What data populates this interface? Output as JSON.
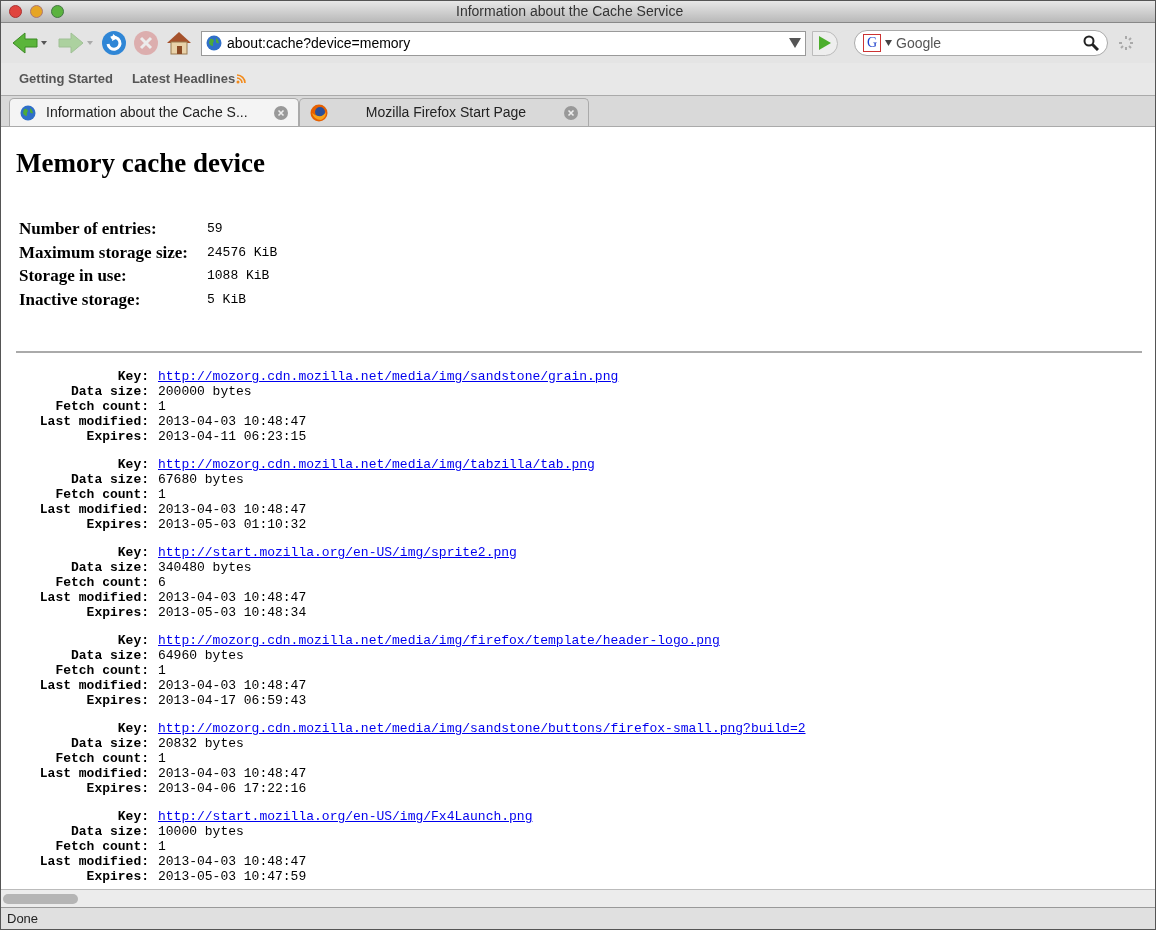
{
  "window": {
    "title": "Information about the Cache Service"
  },
  "toolbar": {
    "back_enabled": true,
    "forward_enabled": false,
    "stop_enabled": false,
    "address": "about:cache?device=memory",
    "search_engine": "G",
    "search_placeholder": "Google"
  },
  "bookmarks": [
    {
      "label": "Getting Started",
      "rss": false
    },
    {
      "label": "Latest Headlines",
      "rss": true
    }
  ],
  "tabs": [
    {
      "label": "Information about the Cache S...",
      "selected": true,
      "kind": "globe"
    },
    {
      "label": "Mozilla Firefox Start Page",
      "selected": false,
      "kind": "firefox"
    }
  ],
  "page": {
    "heading": "Memory cache device",
    "stats": [
      {
        "label": "Number of entries:",
        "value": "59"
      },
      {
        "label": "Maximum storage size:",
        "value": "24576 KiB"
      },
      {
        "label": "Storage in use:",
        "value": "1088 KiB"
      },
      {
        "label": "Inactive storage:",
        "value": "5 KiB"
      }
    ],
    "entries": [
      {
        "fields": [
          {
            "label": "Key:",
            "value": "http://mozorg.cdn.mozilla.net/media/img/sandstone/grain.png",
            "kind": "link"
          },
          {
            "label": "Data size:",
            "value": "200000 bytes",
            "kind": "text"
          },
          {
            "label": "Fetch count:",
            "value": "1",
            "kind": "text"
          },
          {
            "label": "Last modified:",
            "value": "2013-04-03 10:48:47",
            "kind": "text"
          },
          {
            "label": "Expires:",
            "value": "2013-04-11 06:23:15",
            "kind": "text"
          }
        ]
      },
      {
        "fields": [
          {
            "label": "Key:",
            "value": "http://mozorg.cdn.mozilla.net/media/img/tabzilla/tab.png",
            "kind": "link"
          },
          {
            "label": "Data size:",
            "value": "67680 bytes",
            "kind": "text"
          },
          {
            "label": "Fetch count:",
            "value": "1",
            "kind": "text"
          },
          {
            "label": "Last modified:",
            "value": "2013-04-03 10:48:47",
            "kind": "text"
          },
          {
            "label": "Expires:",
            "value": "2013-05-03 01:10:32",
            "kind": "text"
          }
        ]
      },
      {
        "fields": [
          {
            "label": "Key:",
            "value": "http://start.mozilla.org/en-US/img/sprite2.png",
            "kind": "link"
          },
          {
            "label": "Data size:",
            "value": "340480 bytes",
            "kind": "text"
          },
          {
            "label": "Fetch count:",
            "value": "6",
            "kind": "text"
          },
          {
            "label": "Last modified:",
            "value": "2013-04-03 10:48:47",
            "kind": "text"
          },
          {
            "label": "Expires:",
            "value": "2013-05-03 10:48:34",
            "kind": "text"
          }
        ]
      },
      {
        "fields": [
          {
            "label": "Key:",
            "value": "http://mozorg.cdn.mozilla.net/media/img/firefox/template/header-logo.png",
            "kind": "link"
          },
          {
            "label": "Data size:",
            "value": "64960 bytes",
            "kind": "text"
          },
          {
            "label": "Fetch count:",
            "value": "1",
            "kind": "text"
          },
          {
            "label": "Last modified:",
            "value": "2013-04-03 10:48:47",
            "kind": "text"
          },
          {
            "label": "Expires:",
            "value": "2013-04-17 06:59:43",
            "kind": "text"
          }
        ]
      },
      {
        "fields": [
          {
            "label": "Key:",
            "value": "http://mozorg.cdn.mozilla.net/media/img/sandstone/buttons/firefox-small.png?build=2",
            "kind": "link"
          },
          {
            "label": "Data size:",
            "value": "20832 bytes",
            "kind": "text"
          },
          {
            "label": "Fetch count:",
            "value": "1",
            "kind": "text"
          },
          {
            "label": "Last modified:",
            "value": "2013-04-03 10:48:47",
            "kind": "text"
          },
          {
            "label": "Expires:",
            "value": "2013-04-06 17:22:16",
            "kind": "text"
          }
        ]
      },
      {
        "fields": [
          {
            "label": "Key:",
            "value": "http://start.mozilla.org/en-US/img/Fx4Launch.png",
            "kind": "link"
          },
          {
            "label": "Data size:",
            "value": "10000 bytes",
            "kind": "text"
          },
          {
            "label": "Fetch count:",
            "value": "1",
            "kind": "text"
          },
          {
            "label": "Last modified:",
            "value": "2013-04-03 10:48:47",
            "kind": "text"
          },
          {
            "label": "Expires:",
            "value": "2013-05-03 10:47:59",
            "kind": "text"
          }
        ]
      }
    ]
  },
  "status_bar": {
    "text": "Done"
  }
}
